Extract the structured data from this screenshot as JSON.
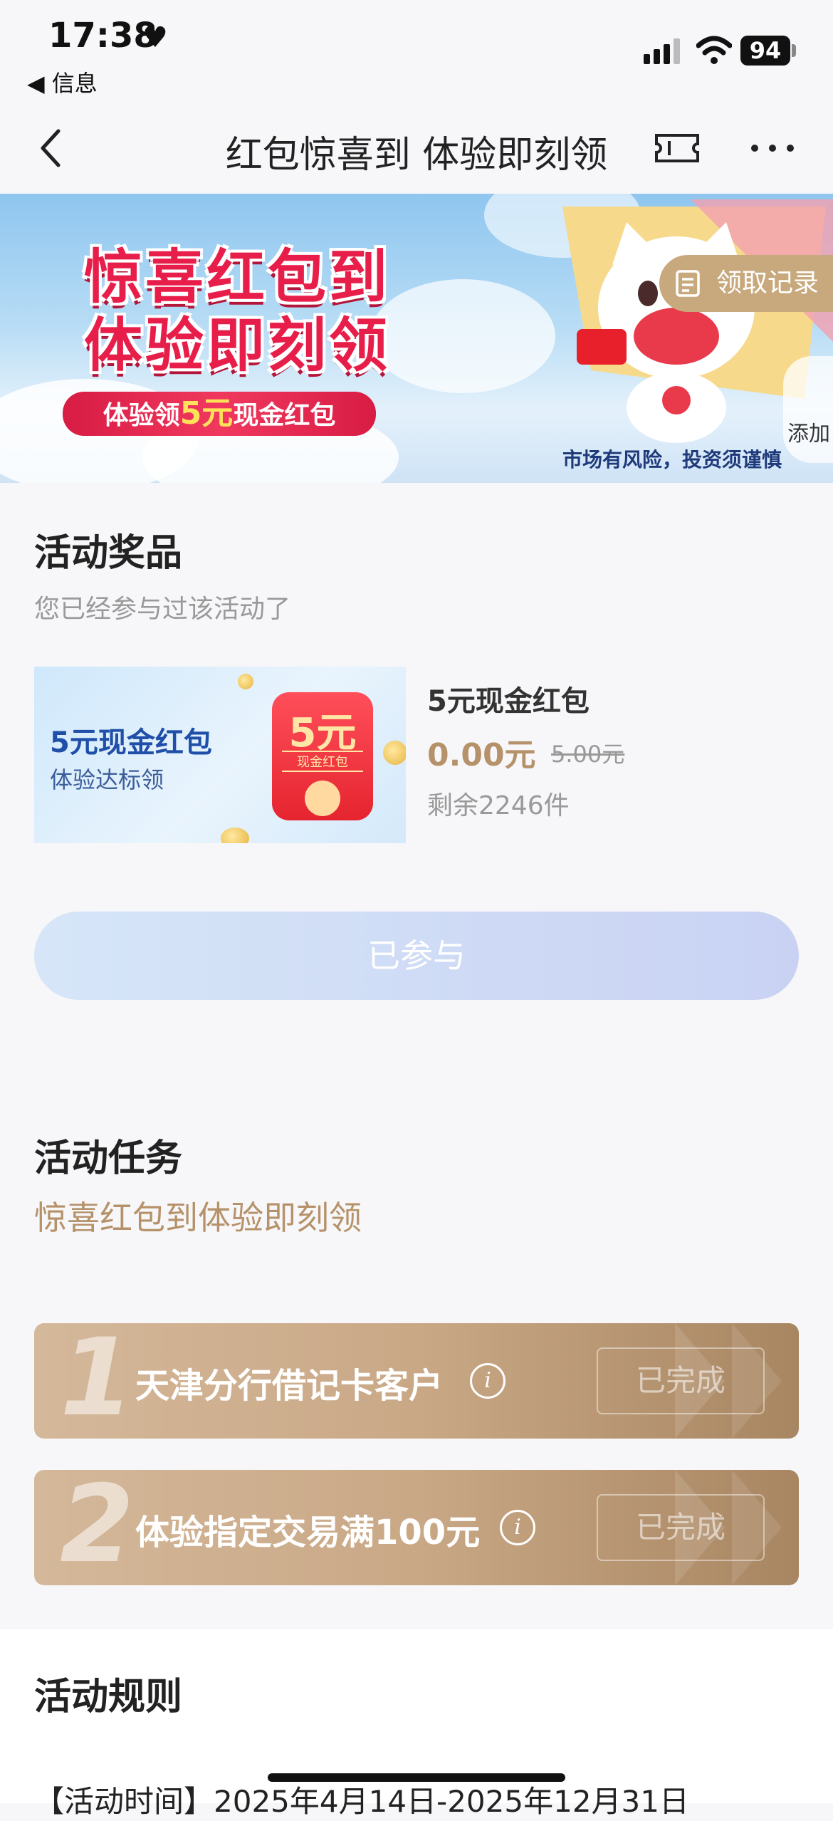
{
  "status_bar": {
    "time": "17:38",
    "back_app": "◀ 信息",
    "battery": "94"
  },
  "nav": {
    "title": "红包惊喜到 体验即刻领",
    "icons": [
      "back-arrow-icon",
      "ticket-icon",
      "more-icon"
    ]
  },
  "banner": {
    "headline_1": "惊喜红包到",
    "headline_2": "体验即刻领",
    "sub_prefix": "体验领",
    "sub_amount": "5元",
    "sub_suffix": "现金红包",
    "risk_notice": "市场有风险，投资须谨慎",
    "records_button": "领取记录",
    "add_button": "添加"
  },
  "prize_section": {
    "title": "活动奖品",
    "subtitle": "您已经参与过该活动了",
    "image": {
      "title": "5元现金红包",
      "subtitle": "体验达标领",
      "envelope_amount": "5元",
      "envelope_label": "现金红包"
    },
    "name": "5元现金红包",
    "price": "0.00元",
    "original_price": "5.00元",
    "stock": "剩余2246件",
    "button": "已参与"
  },
  "task_section": {
    "title": "活动任务",
    "subtitle": "惊喜红包到体验即刻领",
    "tasks": [
      {
        "number": "1",
        "label": "天津分行借记卡客户",
        "status": "已完成"
      },
      {
        "number": "2",
        "label": "体验指定交易满100元",
        "status": "已完成"
      }
    ]
  },
  "rules_section": {
    "title": "活动规则",
    "text": "【活动时间】2025年4月14日-2025年12月31日"
  },
  "colors": {
    "accent_gold": "#b6926a",
    "banner_red": "#e81e4a",
    "task_card": "#c9a886"
  }
}
